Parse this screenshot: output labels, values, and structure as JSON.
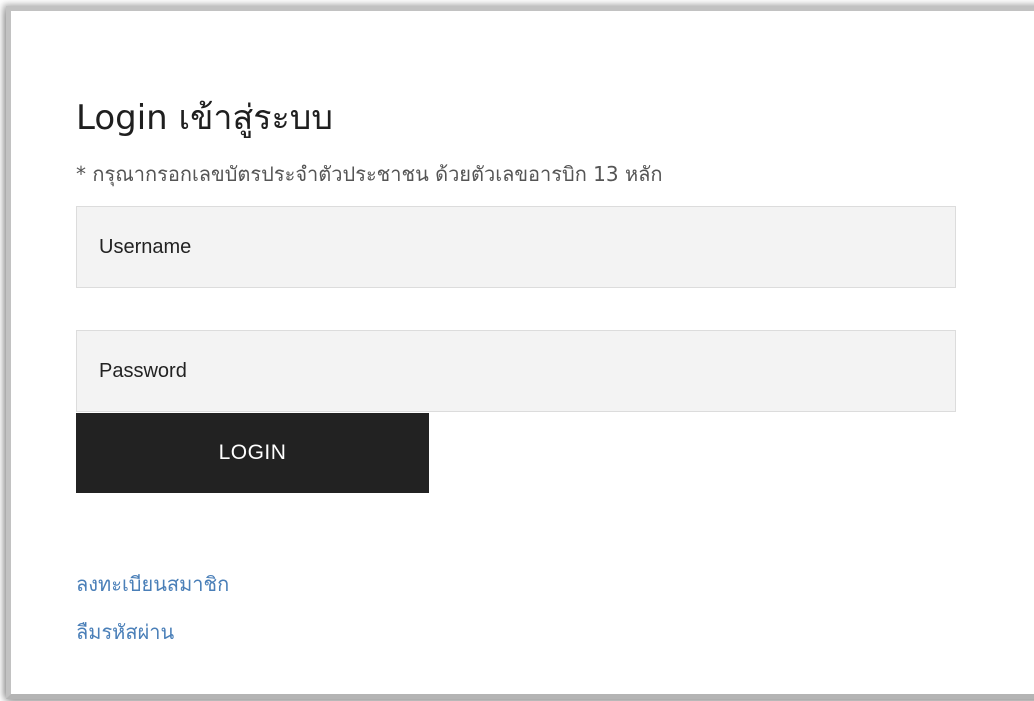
{
  "login": {
    "title": "Login เข้าสู่ระบบ",
    "hint": "* กรุณากรอกเลขบัตรประจำตัวประชาชน ด้วยตัวเลขอารบิก 13 หลัก",
    "username_placeholder": "Username",
    "password_placeholder": "Password",
    "login_button_label": "LOGIN",
    "register_link": "ลงทะเบียนสมาชิก",
    "forgot_password_link": "ลืมรหัสผ่าน"
  },
  "colors": {
    "button_bg": "#222222",
    "link": "#4a7fb8",
    "field_bg": "#f3f3f3"
  }
}
